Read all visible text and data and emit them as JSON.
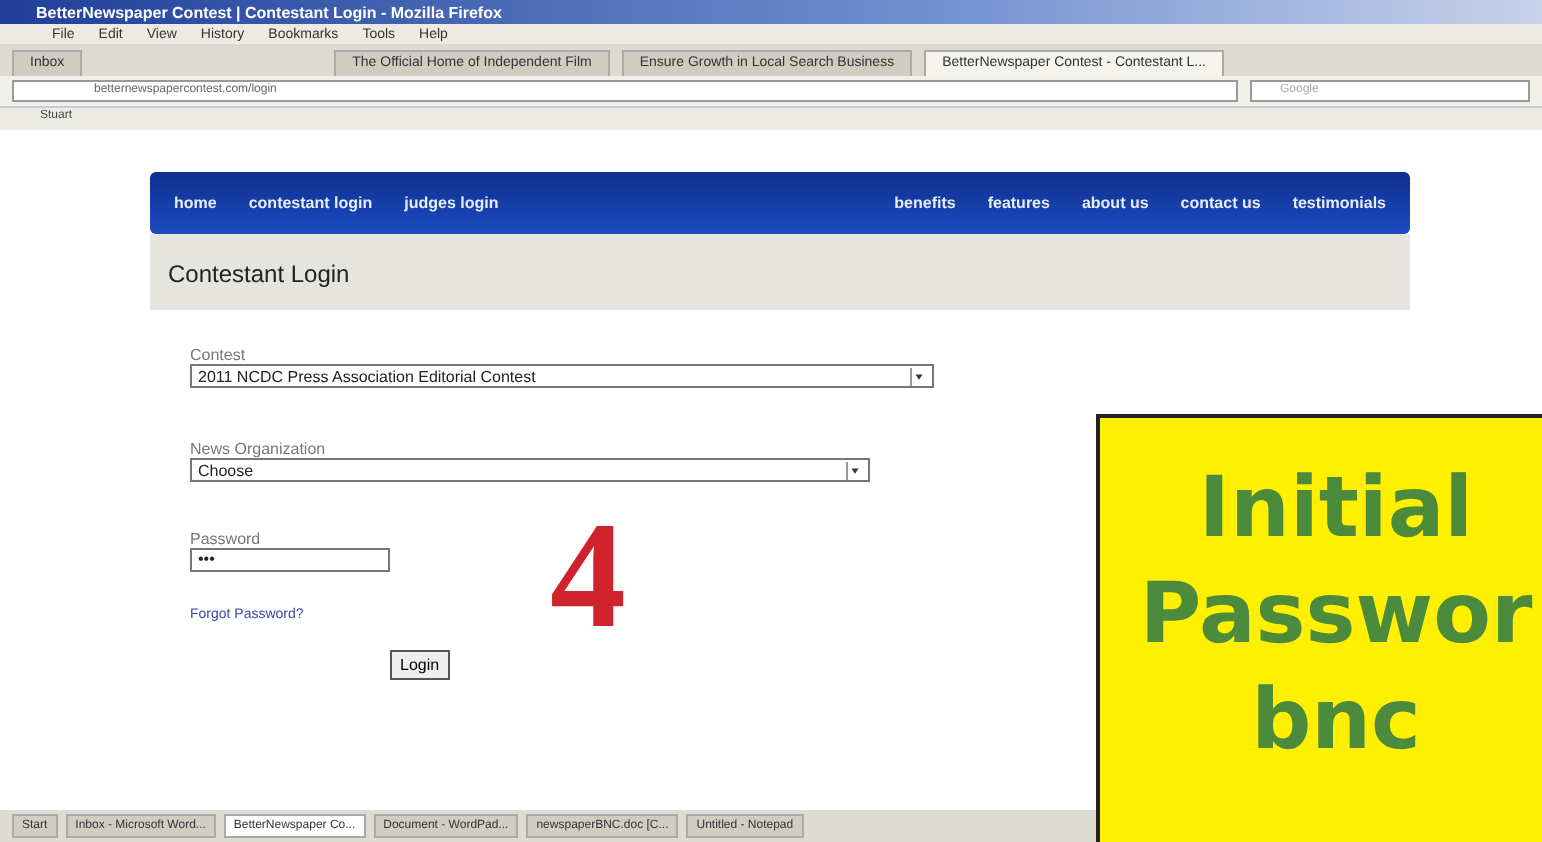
{
  "window": {
    "title": "BetterNewspaper Contest | Contestant Login - Mozilla Firefox"
  },
  "menu": [
    "File",
    "Edit",
    "View",
    "History",
    "Bookmarks",
    "Tools",
    "Help"
  ],
  "tabs": [
    {
      "label": "Inbox",
      "selected": false
    },
    {
      "label": "The Official Home of Independent Film",
      "selected": false
    },
    {
      "label": "Ensure Growth in Local Search Business",
      "selected": false
    },
    {
      "label": "BetterNewspaper Contest - Contestant L...",
      "selected": true
    }
  ],
  "address": {
    "value": "betternewspapercontest.com/login"
  },
  "search": {
    "placeholder": "Google"
  },
  "bookmarks": [
    "Stuart"
  ],
  "nav": {
    "left": [
      "home",
      "contestant login",
      "judges login"
    ],
    "right": [
      "benefits",
      "features",
      "about us",
      "contact us",
      "testimonials"
    ]
  },
  "page_title": "Contestant Login",
  "form": {
    "contest": {
      "label": "Contest",
      "value": "2011 NCDC Press Association Editorial Contest"
    },
    "organization": {
      "label": "News Organization",
      "value": "Choose"
    },
    "password": {
      "label": "Password",
      "value": "•••"
    },
    "forgot": "Forgot Password?",
    "button": "Login"
  },
  "step": "4",
  "callout": [
    "Initial",
    "Passwor",
    "bnc"
  ],
  "taskbar": [
    {
      "label": "Start",
      "selected": false
    },
    {
      "label": "Inbox - Microsoft Word...",
      "selected": false
    },
    {
      "label": "BetterNewspaper Co...",
      "selected": true
    },
    {
      "label": "Document - WordPad...",
      "selected": false
    },
    {
      "label": "newspaperBNC.doc [C...",
      "selected": false
    },
    {
      "label": "Untitled - Notepad",
      "selected": false
    }
  ]
}
